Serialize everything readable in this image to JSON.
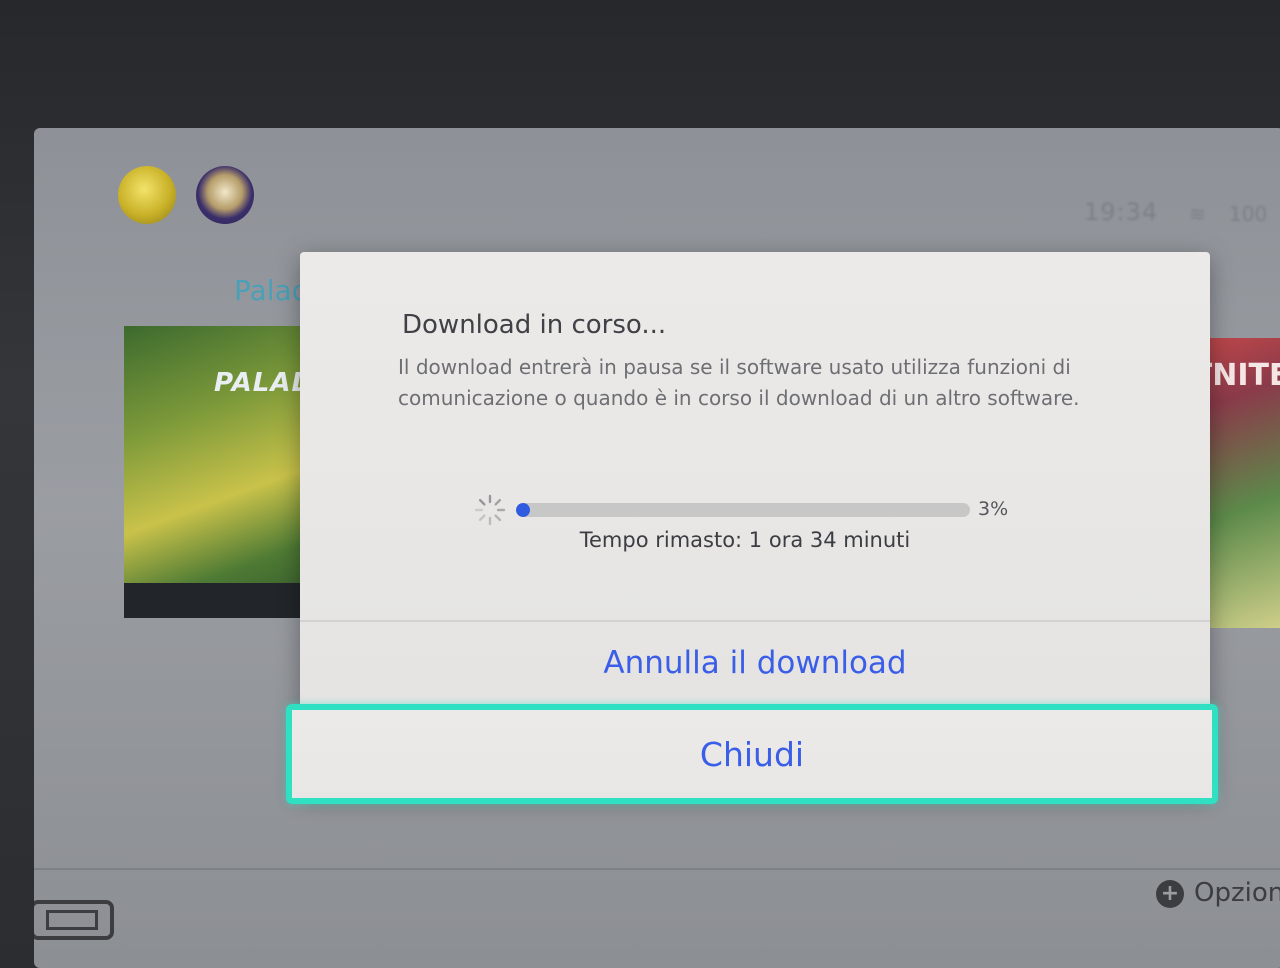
{
  "home": {
    "status_time": "19:34",
    "status_battery": "100",
    "game_label": "Palad",
    "tile_left_text": "PALAD",
    "tile_right_text": "RTNITE",
    "options_label": "Opzion",
    "options_icon": "plus-icon"
  },
  "dialog": {
    "title": "Download in corso...",
    "body": "Il download entrerà in pausa se il software usato utilizza funzioni di comunicazione o quando è in corso il download di un altro software.",
    "progress_percent_value": 3,
    "progress_percent_label": "3%",
    "time_remaining": "Tempo rimasto: 1 ora 34 minuti",
    "cancel_label": "Annulla il download",
    "close_label": "Chiudi"
  },
  "colors": {
    "accent_blue": "#3b5ee8",
    "focus_cyan": "#2fe0c2",
    "progress_fill": "#2f5be0"
  }
}
